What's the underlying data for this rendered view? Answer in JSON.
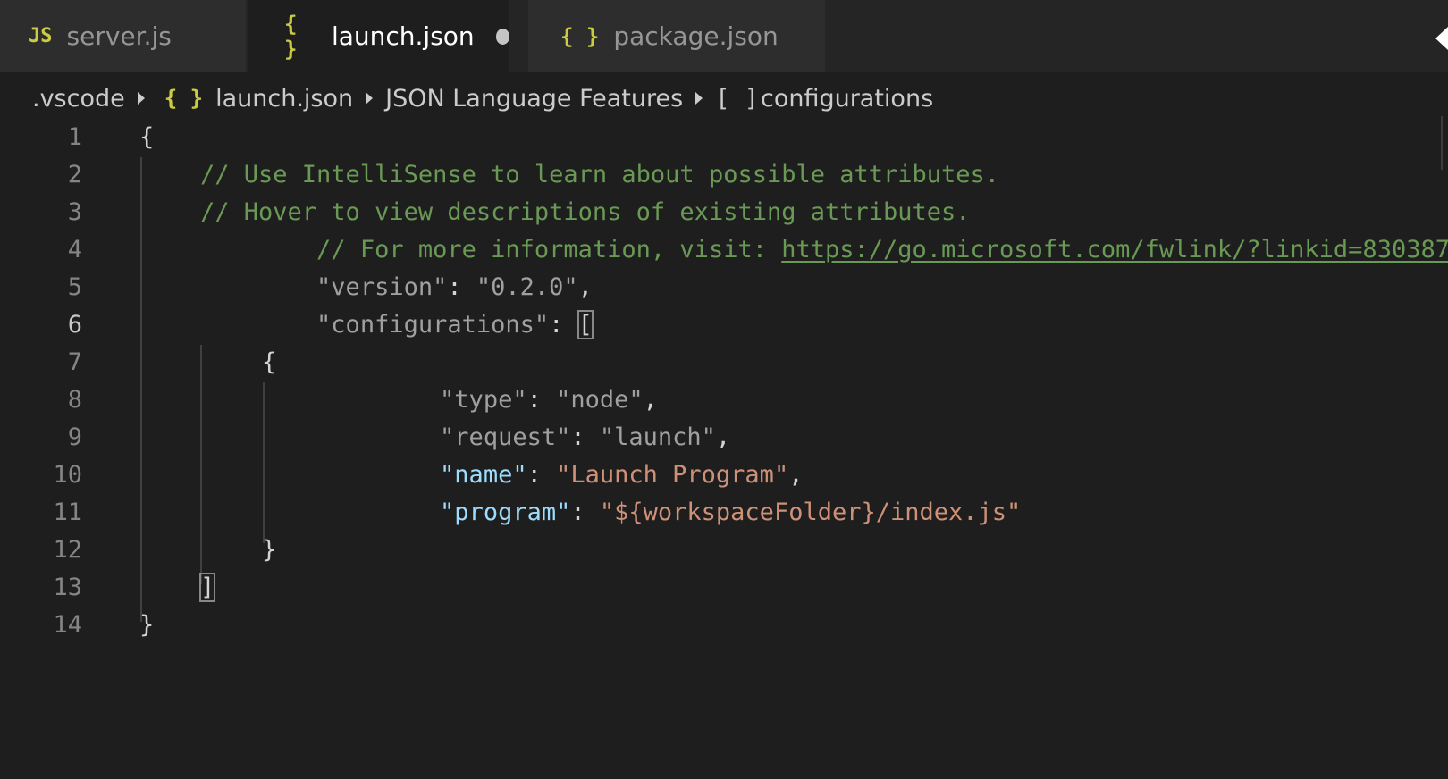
{
  "tabs": [
    {
      "icon": "JS",
      "label": "server.js",
      "active": false
    },
    {
      "icon": "{ }",
      "label": "launch.json",
      "active": true,
      "dirty": true
    },
    {
      "icon": "{ }",
      "label": "package.json",
      "active": false
    }
  ],
  "breadcrumb": {
    "folder": ".vscode",
    "file_icon": "{ }",
    "file": "launch.json",
    "section": "JSON Language Features",
    "symbol_icon": "[ ]",
    "symbol": "configurations"
  },
  "code": {
    "current_line": 6,
    "lines": [
      {
        "n": "1",
        "t1": "{"
      },
      {
        "n": "2",
        "t1": "// Use IntelliSense to learn about possible attributes."
      },
      {
        "n": "3",
        "t1": "// Hover to view descriptions of existing attributes."
      },
      {
        "n": "4",
        "t1": "// For more information, visit: ",
        "t2": "https://go.microsoft.com/fwlink/?linkid=830387"
      },
      {
        "n": "5",
        "t1": "\"version\"",
        "t2": ": ",
        "t3": "\"0.2.0\"",
        "t4": ","
      },
      {
        "n": "6",
        "t1": "\"configurations\"",
        "t2": ": ",
        "t3": "["
      },
      {
        "n": "7",
        "t1": "{"
      },
      {
        "n": "8",
        "t1": "\"type\"",
        "t2": ": ",
        "t3": "\"node\"",
        "t4": ","
      },
      {
        "n": "9",
        "t1": "\"request\"",
        "t2": ": ",
        "t3": "\"launch\"",
        "t4": ","
      },
      {
        "n": "10",
        "t1": "\"name\"",
        "t2": ": ",
        "t3": "\"Launch Program\"",
        "t4": ","
      },
      {
        "n": "11",
        "t1": "\"program\"",
        "t2": ": ",
        "t3": "\"${workspaceFolder}/index.js\""
      },
      {
        "n": "12",
        "t1": "}"
      },
      {
        "n": "13",
        "t1": "]"
      },
      {
        "n": "14",
        "t1": "}"
      }
    ]
  },
  "colors": {
    "background": "#1e1e1e",
    "comment": "#6a9955",
    "key": "#9cdcfe",
    "string": "#ce9178",
    "json_icon": "#cbcb41"
  }
}
